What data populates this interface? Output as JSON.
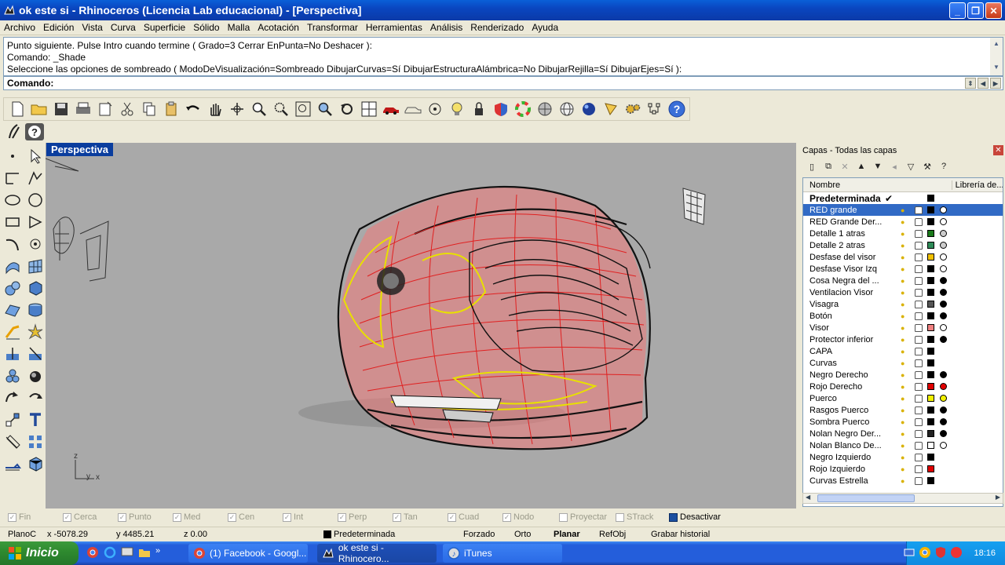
{
  "window": {
    "title": "ok este si - Rhinoceros (Licencia Lab educacional) - [Perspectiva]"
  },
  "menu": [
    "Archivo",
    "Edición",
    "Vista",
    "Curva",
    "Superficie",
    "Sólido",
    "Malla",
    "Acotación",
    "Transformar",
    "Herramientas",
    "Análisis",
    "Renderizado",
    "Ayuda"
  ],
  "command": {
    "history": [
      "Punto siguiente. Pulse Intro cuando termine ( Grado=3  Cerrar  EnPunta=No  Deshacer ):",
      "Comando: _Shade",
      "Seleccione las opciones de sombreado ( ModoDeVisualización=Sombreado  DibujarCurvas=Sí  DibujarEstructuraAlámbrica=No  DibujarRejilla=Sí  DibujarEjes=Sí ):"
    ],
    "prompt": "Comando:"
  },
  "viewport": {
    "title": "Perspectiva",
    "axes": {
      "z": "z",
      "y": "y",
      "x": "x"
    }
  },
  "layers": {
    "title": "Capas - Todas las capas",
    "col_name": "Nombre",
    "col_lib": "Librería de...",
    "rows": [
      {
        "name": "Predeterminada",
        "color": "#000000",
        "mat": null
      },
      {
        "name": "RED grande",
        "color": "#000000",
        "mat": "#ffffff"
      },
      {
        "name": "RED Grande Der...",
        "color": "#000000",
        "mat": "#ffffff"
      },
      {
        "name": "Detalle 1 atras",
        "color": "#1a7a1a",
        "mat": "#cccccc"
      },
      {
        "name": "Detalle 2 atras",
        "color": "#2e8b57",
        "mat": "#cccccc"
      },
      {
        "name": "Desfase del visor",
        "color": "#f0c000",
        "mat": "#ffffff"
      },
      {
        "name": "Desfase Visor Izq",
        "color": "#000000",
        "mat": "#ffffff"
      },
      {
        "name": "Cosa Negra del ...",
        "color": "#000000",
        "mat": "#000000"
      },
      {
        "name": "Ventilacion Visor",
        "color": "#000000",
        "mat": "#000000"
      },
      {
        "name": "Visagra",
        "color": "#555555",
        "mat": "#000000"
      },
      {
        "name": "Botón",
        "color": "#000000",
        "mat": "#000000"
      },
      {
        "name": "Visor",
        "color": "#f08080",
        "mat": "#ffffff"
      },
      {
        "name": "Protector inferior",
        "color": "#000000",
        "mat": "#000000"
      },
      {
        "name": "CAPA",
        "color": "#000000",
        "mat": null
      },
      {
        "name": "Curvas",
        "color": "#000000",
        "mat": null
      },
      {
        "name": "Negro Derecho",
        "color": "#000000",
        "mat": "#000000"
      },
      {
        "name": "Rojo Derecho",
        "color": "#e00000",
        "mat": "#e00000"
      },
      {
        "name": "Puerco",
        "color": "#f0f000",
        "mat": "#f0f000"
      },
      {
        "name": "Rasgos Puerco",
        "color": "#000000",
        "mat": "#000000"
      },
      {
        "name": "Sombra Puerco",
        "color": "#000000",
        "mat": "#000000"
      },
      {
        "name": "Nolan Negro Der...",
        "color": "#222222",
        "mat": "#000000"
      },
      {
        "name": "Nolan Blanco De...",
        "color": "#ffffff",
        "mat": "#ffffff"
      },
      {
        "name": "Negro Izquierdo",
        "color": "#000000",
        "mat": null
      },
      {
        "name": "Rojo Izquierdo",
        "color": "#e00000",
        "mat": null
      },
      {
        "name": "Curvas Estrella",
        "color": "#000000",
        "mat": null
      }
    ]
  },
  "osnaps": [
    "Fin",
    "Cerca",
    "Punto",
    "Med",
    "Cen",
    "Int",
    "Perp",
    "Tan",
    "Cuad",
    "Nodo",
    "Proyectar",
    "STrack",
    "Desactivar"
  ],
  "status": {
    "plane": "PlanoC",
    "x": "x -5078.29",
    "y": "y 4485.21",
    "z": "z 0.00",
    "layer": "Predeterminada",
    "snap": "Forzado",
    "ortho": "Orto",
    "planar": "Planar",
    "osnap": "RefObj",
    "history": "Grabar historial"
  },
  "taskbar": {
    "start": "Inicio",
    "tasks": [
      "(1) Facebook - Googl...",
      "ok este si - Rhinocero...",
      "iTunes"
    ],
    "clock": "18:16"
  }
}
